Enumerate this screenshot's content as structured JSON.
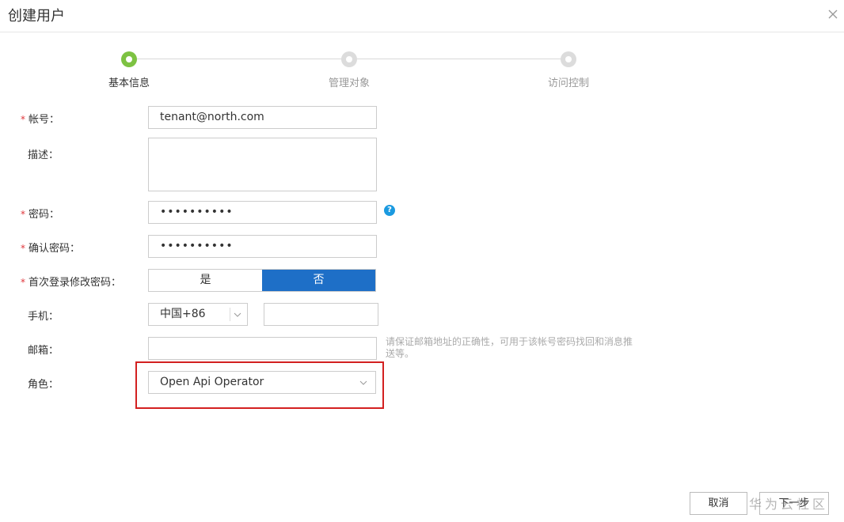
{
  "dialog": {
    "title": "创建用户",
    "close_icon": "close-icon"
  },
  "steps": [
    {
      "label": "基本信息",
      "state": "active"
    },
    {
      "label": "管理对象",
      "state": "pending"
    },
    {
      "label": "访问控制",
      "state": "pending"
    }
  ],
  "form": {
    "required_mark": "*",
    "account": {
      "label": "帐号：",
      "value": "tenant@north.com",
      "required": true
    },
    "description": {
      "label": "描述：",
      "value": ""
    },
    "password": {
      "label": "密码：",
      "value": "••••••••••",
      "required": true,
      "help_icon": "help-icon",
      "help_glyph": "?"
    },
    "confirm_password": {
      "label": "确认密码：",
      "value": "••••••••••",
      "required": true
    },
    "first_login_change": {
      "label": "首次登录修改密码：",
      "required": true,
      "options": [
        "是",
        "否"
      ],
      "selected": "否"
    },
    "phone": {
      "label": "手机：",
      "country_code": "中国+86",
      "value": ""
    },
    "email": {
      "label": "邮箱：",
      "value": "",
      "hint": "请保证邮箱地址的正确性，可用于该帐号密码找回和消息推送等。"
    },
    "role": {
      "label": "角色：",
      "value": "Open Api Operator"
    }
  },
  "buttons": {
    "cancel": "取消",
    "next": "下一步"
  },
  "watermark": "华为云社区",
  "colors": {
    "accent": "#1e6fc7",
    "step_active": "#7dc242",
    "required": "#e0373c",
    "highlight": "#d32020",
    "help": "#1b9ae0"
  }
}
